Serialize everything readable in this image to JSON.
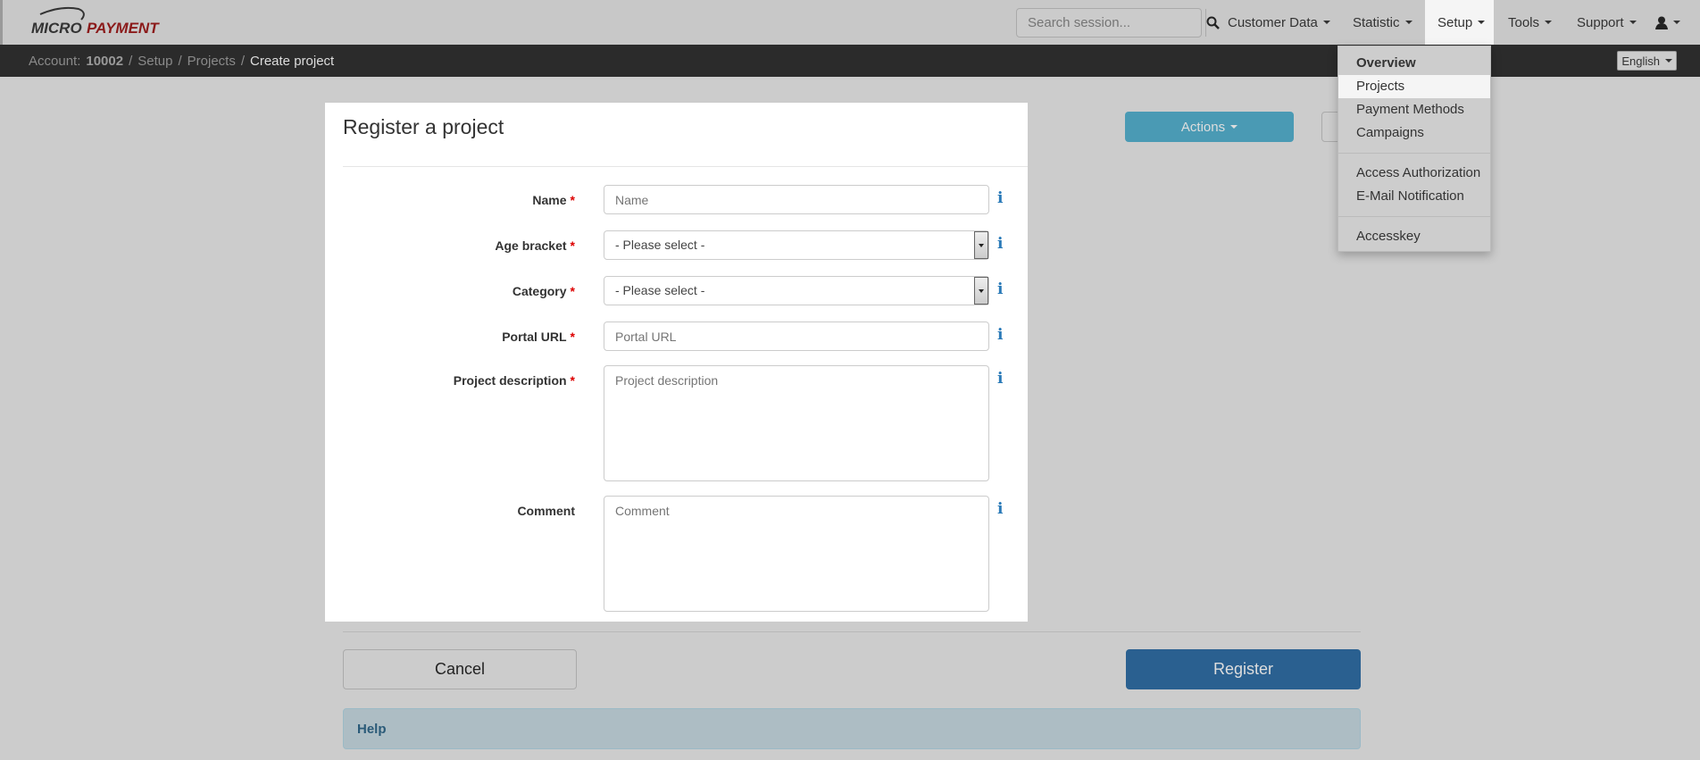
{
  "brand": {
    "micro": "MICRO",
    "payment": "PAYMENT"
  },
  "search": {
    "placeholder": "Search session..."
  },
  "nav": {
    "customer_data": "Customer Data",
    "statistic": "Statistic",
    "setup": "Setup",
    "tools": "Tools",
    "support": "Support"
  },
  "breadcrumb": {
    "account_label": "Account:",
    "account_id": "10002",
    "sep": "/",
    "setup": "Setup",
    "projects": "Projects",
    "current": "Create project"
  },
  "language": "English",
  "setup_menu": {
    "items": [
      "Overview",
      "Projects",
      "Payment Methods",
      "Campaigns",
      "Access Authorization",
      "E-Mail Notification",
      "Accesskey"
    ]
  },
  "toolbar": {
    "actions": "Actions"
  },
  "form": {
    "title": "Register a project",
    "required_mark": "*",
    "info": "i",
    "name": {
      "label": "Name",
      "placeholder": "Name"
    },
    "age": {
      "label": "Age bracket",
      "value": "- Please select -"
    },
    "category": {
      "label": "Category",
      "value": "- Please select -"
    },
    "portal": {
      "label": "Portal URL",
      "placeholder": "Portal URL"
    },
    "description": {
      "label": "Project description",
      "placeholder": "Project description"
    },
    "comment": {
      "label": "Comment",
      "placeholder": "Comment"
    }
  },
  "buttons": {
    "cancel": "Cancel",
    "register": "Register"
  },
  "help": {
    "title": "Help"
  }
}
